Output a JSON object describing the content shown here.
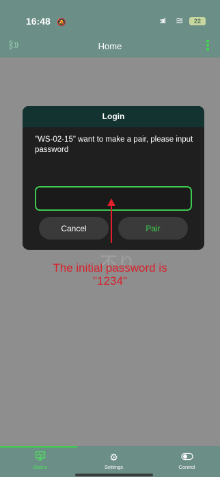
{
  "status_bar": {
    "time": "16:48",
    "battery": "22"
  },
  "header": {
    "title": "Home",
    "bluetooth_icon": "bluetooth-icon",
    "menu_icon": "more-vertical-icon"
  },
  "background_glyph": "不り",
  "dialog": {
    "title": "Login",
    "message": "\"WS-02-15\" want to make a pair, please input password",
    "password_value": "",
    "cancel_label": "Cancel",
    "pair_label": "Pair"
  },
  "annotation": {
    "text_line1": "The initial password is",
    "text_line2": "\"1234\"",
    "color": "#d8202a"
  },
  "tabs": [
    {
      "label": "Status",
      "icon": "monitor-icon",
      "active": true
    },
    {
      "label": "Settings",
      "icon": "gear-icon",
      "active": false
    },
    {
      "label": "Control",
      "icon": "toggle-icon",
      "active": false
    }
  ],
  "colors": {
    "header": "#6b8e86",
    "accent": "#3fd04e",
    "dialog_title": "#123330",
    "dialog_bg": "#1f1f1f"
  }
}
